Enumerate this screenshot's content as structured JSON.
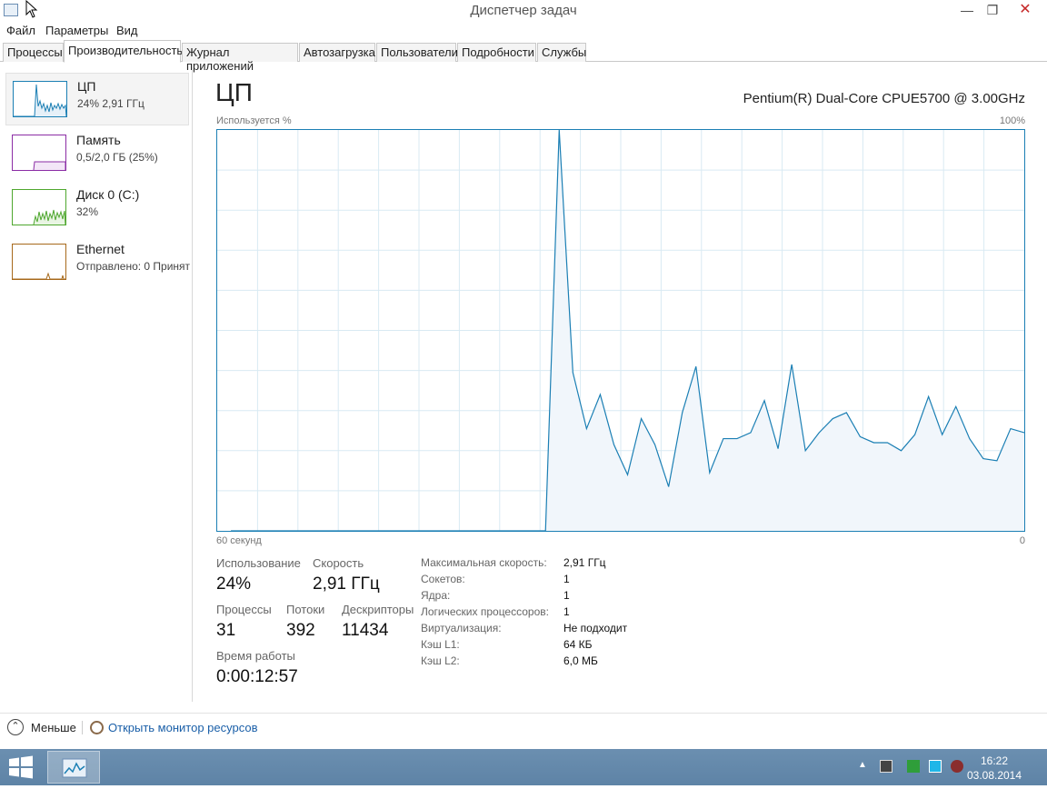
{
  "window": {
    "title": "Диспетчер задач"
  },
  "menu": [
    "Файл",
    "Параметры",
    "Вид"
  ],
  "tabs": [
    "Процессы",
    "Производительность",
    "Журнал приложений",
    "Автозагрузка",
    "Пользователи",
    "Подробности",
    "Службы"
  ],
  "active_tab": "Производительность",
  "sidebar": {
    "items": [
      {
        "title": "ЦП",
        "subtitle": "24% 2,91 ГГц",
        "color": "#1b7fb4"
      },
      {
        "title": "Память",
        "subtitle": "0,5/2,0 ГБ (25%)",
        "color": "#8b2da5"
      },
      {
        "title": "Диск 0 (C:)",
        "subtitle": "32%",
        "color": "#4ea72e"
      },
      {
        "title": "Ethernet",
        "subtitle": "Отправлено: 0 Принят",
        "color": "#a7691b"
      }
    ]
  },
  "main": {
    "title": "ЦП",
    "cpu_model": "Pentium(R) Dual-Core CPUE5700 @ 3.00GHz",
    "graph": {
      "y_label": "Используется %",
      "y_max_label": "100%",
      "x_left_label": "60 секунд",
      "x_right_label": "0",
      "color": "#1b7fb4",
      "fill": "#f1f6fb",
      "values": [
        0,
        0,
        0,
        0,
        0,
        0,
        0,
        0,
        0,
        0,
        0,
        0,
        0,
        0,
        0,
        0,
        0,
        0,
        0,
        0,
        0,
        0,
        0,
        0,
        100,
        39.5,
        25.5,
        34,
        21.5,
        14,
        28,
        21.5,
        11,
        29.5,
        41,
        14.5,
        23,
        23,
        24.5,
        32.5,
        20.5,
        41.5,
        20,
        24.5,
        28,
        29.5,
        23.5,
        22,
        22,
        20,
        24,
        33.5,
        24,
        31,
        23,
        18,
        17.5,
        25.5,
        24.5
      ]
    },
    "stats": {
      "usage_label": "Использование",
      "usage_value": "24%",
      "speed_label": "Скорость",
      "speed_value": "2,91 ГГц",
      "processes_label": "Процессы",
      "processes_value": "31",
      "threads_label": "Потоки",
      "threads_value": "392",
      "handles_label": "Дескрипторы",
      "handles_value": "11434",
      "uptime_label": "Время работы",
      "uptime_value": "0:00:12:57"
    },
    "info": [
      {
        "label": "Максимальная скорость:",
        "value": "2,91 ГГц"
      },
      {
        "label": "Сокетов:",
        "value": "1"
      },
      {
        "label": "Ядра:",
        "value": "1"
      },
      {
        "label": "Логических процессоров:",
        "value": "1"
      },
      {
        "label": "Виртуализация:",
        "value": "Не подходит"
      },
      {
        "label": "Кэш L1:",
        "value": "64 КБ"
      },
      {
        "label": "Кэш L2:",
        "value": "6,0 МБ"
      }
    ]
  },
  "footer": {
    "fewer_label": "Меньше",
    "monitor_link": "Открыть монитор ресурсов"
  },
  "taskbar": {
    "time": "16:22",
    "date": "03.08.2014"
  }
}
